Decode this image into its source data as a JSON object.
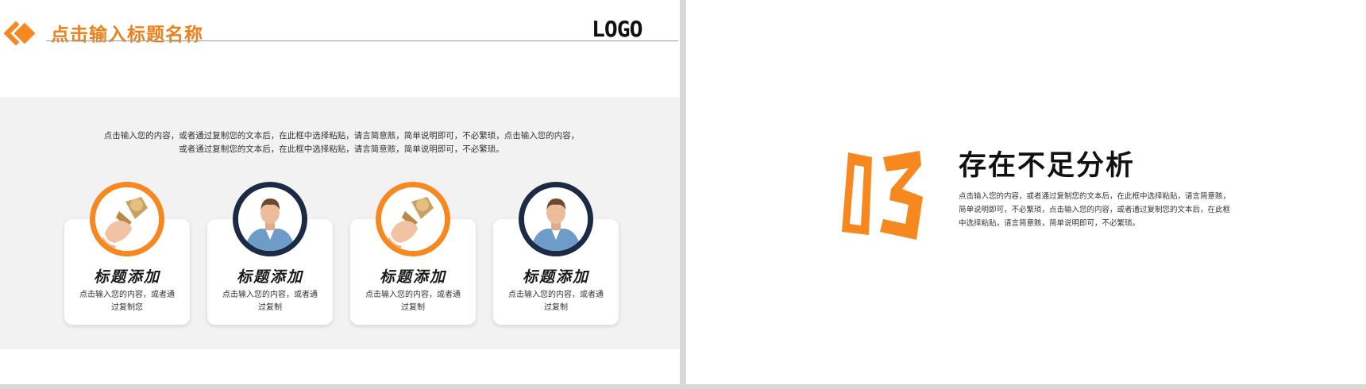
{
  "colors": {
    "accent": "#f7881f",
    "navy": "#1b2b45",
    "band": "#f2f2f2"
  },
  "left_slide": {
    "header": {
      "title": "点击输入标题名称",
      "logo": "LOGO",
      "icon": "diamond-icon"
    },
    "intro_lines": [
      "点击输入您的内容，或者通过复制您的文本后，在此框中选择粘贴，请言简意赅，简单说明即可，不必繁琐，点击输入您的内容，",
      "或者通过复制您的文本后，在此框中选择粘贴，请言简意赅，简单说明即可，不必繁琐。"
    ],
    "cards": [
      {
        "image": "trophy-hand-image",
        "ring": "orange",
        "title": "标题添加",
        "desc": "点击输入您的内容，或者通过复制您"
      },
      {
        "image": "man-portrait-image",
        "ring": "navy",
        "title": "标题添加",
        "desc": "点击输入您的内容，或者通过复制"
      },
      {
        "image": "trophy-hand-image",
        "ring": "orange",
        "title": "标题添加",
        "desc": "点击输入您的内容，或者通过复制"
      },
      {
        "image": "man-portrait-image",
        "ring": "navy",
        "title": "标题添加",
        "desc": "点击输入您的内容，或者通过复制"
      }
    ]
  },
  "right_slide": {
    "number": "03",
    "title": "存在不足分析",
    "desc": "点击输入您的内容，或者通过复制您的文本后，在此框中选择粘贴，请言简意赅，简单说明即可，不必繁琐，点击输入您的内容，或者通过复制您的文本后，在此框中选择粘贴，请言简意赅，简单说明即可，不必繁琐。"
  }
}
